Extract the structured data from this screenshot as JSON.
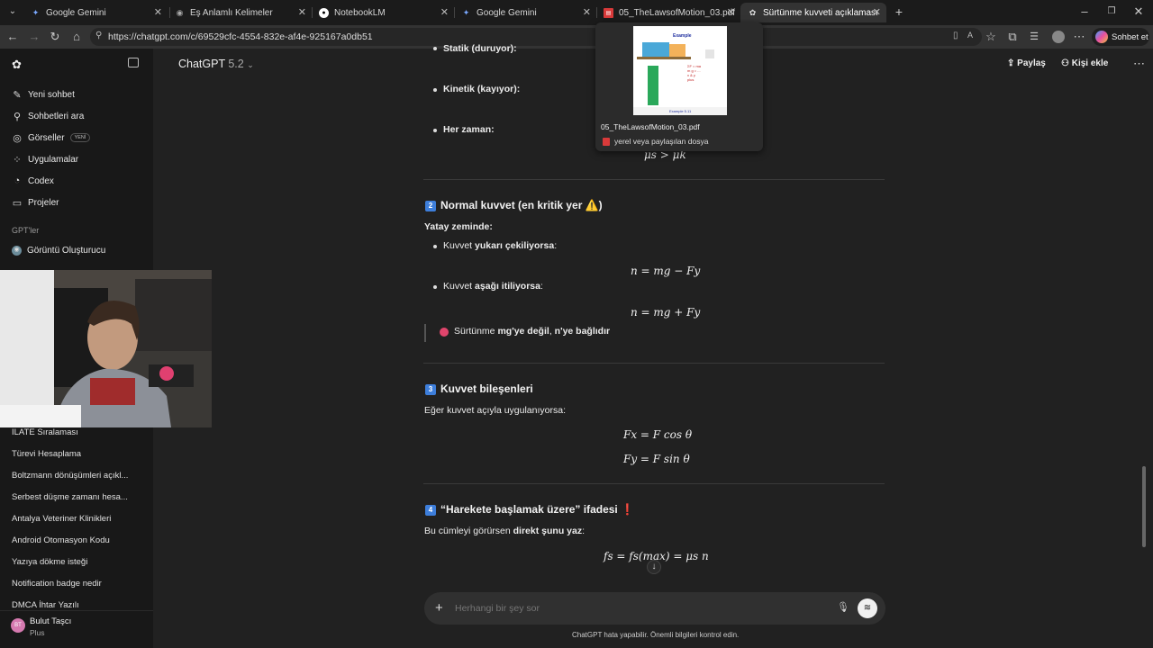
{
  "tabs": [
    {
      "title": "Google Gemini"
    },
    {
      "title": "Eş Anlamlı Kelimeler"
    },
    {
      "title": "NotebookLM"
    },
    {
      "title": "Google Gemini"
    },
    {
      "title": "05_TheLawsofMotion_03.pdf"
    },
    {
      "title": "Sürtünme kuvveti açıklaması"
    }
  ],
  "address": {
    "url": "https://chatgpt.com/c/69529cfc-4554-832e-af4e-925167a0db51"
  },
  "browser": {
    "profile_button": "Sohbet et"
  },
  "sidebar": {
    "items": [
      {
        "label": "Yeni sohbet"
      },
      {
        "label": "Sohbetleri ara"
      },
      {
        "label": "Görseller",
        "badge": "YENİ"
      },
      {
        "label": "Uygulamalar"
      },
      {
        "label": "Codex"
      },
      {
        "label": "Projeler"
      }
    ],
    "gpts_header": "GPT'ler",
    "gpts": [
      {
        "label": "Görüntü Oluşturucu"
      }
    ],
    "history": [
      "ILATE Sıralaması",
      "Türevi Hesaplama",
      "Boltzmann dönüşümleri açıkl...",
      "Serbest düşme zamanı hesa...",
      "Antalya Veteriner Klinikleri",
      "Android Otomasyon Kodu",
      "Yazıya dökme isteği",
      "Notification badge nedir",
      "DMCA İhtar Yazılı"
    ],
    "user": {
      "initials": "BT",
      "name": "Bulut Taşcı",
      "plan": "Plus"
    }
  },
  "header": {
    "model": "ChatGPT",
    "version": "5.2",
    "share": "Paylaş",
    "add_person": "Kişi ekle"
  },
  "content": {
    "static_label": "Statik (duruyor):",
    "kinetic_label": "Kinetik (kayıyor):",
    "always_label": "Her zaman:",
    "always_formula": "μs > μk",
    "sec2_num": "2",
    "sec2_title": "Normal kuvvet (en kritik yer ⚠️)",
    "flat_ground": "Yatay zeminde:",
    "up_prefix": "Kuvvet ",
    "up_bold": "yukarı çekiliyorsa",
    "up_suffix": ":",
    "formula_up": "n = mg − Fy",
    "down_prefix": "Kuvvet ",
    "down_bold": "aşağı itiliyorsa",
    "down_suffix": ":",
    "formula_down": "n = mg + Fy",
    "note_prefix": "Sürtünme ",
    "note_bold1": "mg'ye değil",
    "note_mid": ", ",
    "note_bold2": "n'ye bağlıdır",
    "sec3_num": "3",
    "sec3_title": "Kuvvet bileşenleri",
    "angle_text": "Eğer kuvvet açıyla uygulanıyorsa:",
    "formula_fx": "Fx = F cos θ",
    "formula_fy": "Fy = F sin θ",
    "sec4_num": "4",
    "sec4_title": "“Harekete başlamak üzere” ifadesi ❗",
    "sentence_prefix": "Bu cümleyi görürsen ",
    "sentence_bold": "direkt şunu yaz",
    "sentence_suffix": ":",
    "formula_fs": "fs = fs(max) = μs n"
  },
  "composer": {
    "placeholder": "Herhangi bir şey sor",
    "disclaimer": "ChatGPT hata yapabilir. Önemli bilgileri kontrol edin."
  },
  "popup": {
    "filename": "05_TheLawsofMotion_03.pdf",
    "subtitle": "yerel veya paylaşılan dosya",
    "thumb_heading": "Example",
    "thumb_caption": "Example 5.11"
  },
  "colors": {
    "sidebar_bg": "#181818",
    "main_bg": "#212121",
    "badge_blue": "#3d7edb",
    "note_dot": "#e0456c"
  }
}
